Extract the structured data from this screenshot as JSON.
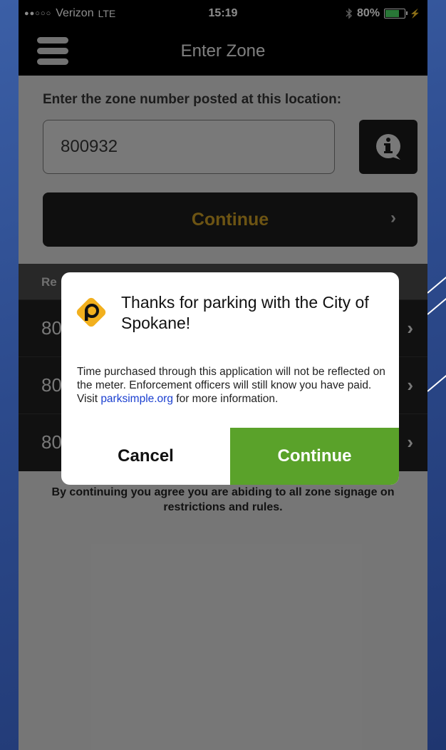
{
  "status_bar": {
    "carrier": "Verizon",
    "network": "LTE",
    "time": "15:19",
    "battery": "80%",
    "battery_level": 0.8
  },
  "nav": {
    "title": "Enter Zone",
    "menu_icon": "hamburger-menu-icon"
  },
  "zone_entry": {
    "prompt": "Enter the zone number posted at this location:",
    "value": "800932",
    "info_icon": "info-speech-bubble-icon",
    "continue_label": "Continue"
  },
  "recent": {
    "header": "Re",
    "rows": [
      "80",
      "80",
      "80"
    ]
  },
  "agreement_text": "By continuing you agree you are abiding to all zone signage on restrictions and rules.",
  "dialog": {
    "title": "Thanks for parking with the City of Spokane!",
    "body_prefix": "Time purchased through this application will not be reflected on the meter.  Enforcement officers will still know you have paid.  Visit ",
    "link_text": "parksimple.org",
    "body_suffix": " for more information.",
    "cancel_label": "Cancel",
    "continue_label": "Continue",
    "logo_icon": "parksimple-logo-icon"
  },
  "colors": {
    "accent_gold": "#c69a24",
    "dialog_continue_green": "#5aa22a",
    "link_blue": "#1a3fd0"
  }
}
